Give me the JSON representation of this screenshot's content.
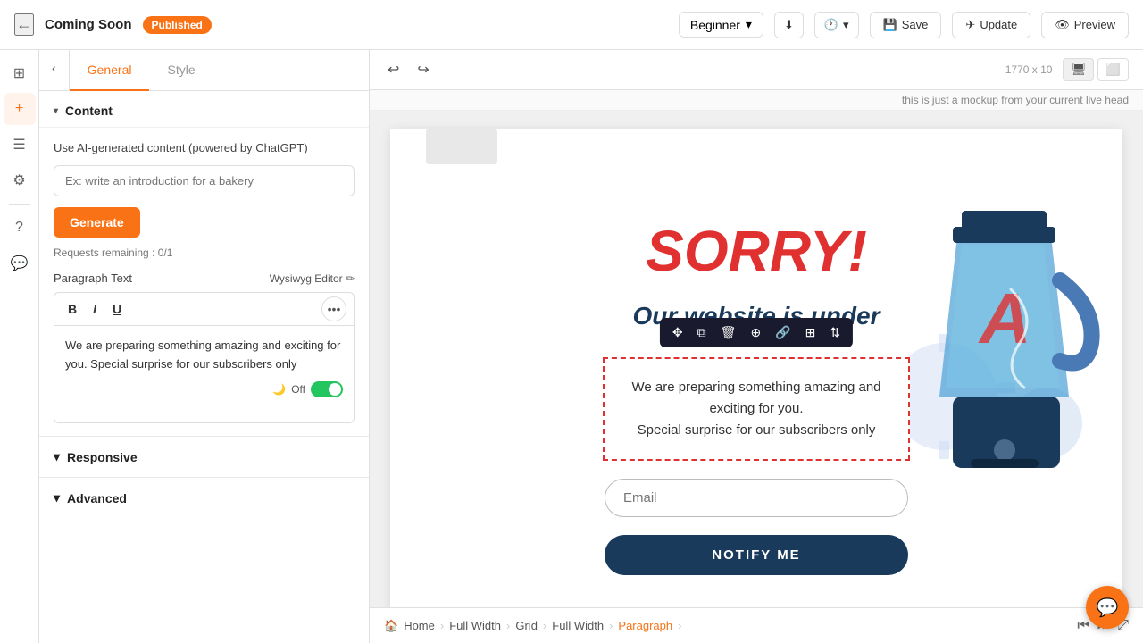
{
  "header": {
    "back_label": "←",
    "title": "Coming Soon",
    "published_badge": "Published",
    "level": "Beginner",
    "save_label": "Save",
    "update_label": "Update",
    "preview_label": "Preview"
  },
  "panel": {
    "back_label": "‹",
    "tab_general": "General",
    "tab_style": "Style",
    "content_section_label": "Content",
    "ai_label": "Use AI-generated content (powered by ChatGPT)",
    "ai_placeholder": "Ex: write an introduction for a bakery",
    "generate_btn": "Generate",
    "requests_remaining": "Requests remaining : 0/1",
    "paragraph_label": "Paragraph Text",
    "wysiwyg_label": "Wysiwyg Editor ✏",
    "bold_label": "B",
    "italic_label": "I",
    "underline_label": "U",
    "editor_text": "We are preparing something amazing and exciting for you. Special surprise for our subscribers only",
    "toggle_label": "Off",
    "responsive_label": "Responsive",
    "advanced_label": "Advanced"
  },
  "canvas": {
    "size_info": "1770 x 10",
    "mockup_notice": "this is just a mockup from your current live head"
  },
  "page_preview": {
    "sorry_title": "SORRY!",
    "under_text": "Our website is under",
    "body_text_line1": "We are preparing something amazing and",
    "body_text_line2": "exciting for you.",
    "body_text_line3": "Special surprise for our subscribers only",
    "email_placeholder": "Email",
    "notify_btn": "NOTIFY ME"
  },
  "breadcrumb": {
    "items": [
      "Home",
      "Full Width",
      "Grid",
      "Full Width",
      "Paragraph"
    ]
  },
  "icons": {
    "back": "←",
    "undo": "↩",
    "redo": "↪",
    "desktop": "🖥",
    "tablet": "⬜",
    "pages": "⊞",
    "add": "+",
    "layers": "☰",
    "settings": "⚙",
    "help": "?",
    "chat": "💬"
  }
}
